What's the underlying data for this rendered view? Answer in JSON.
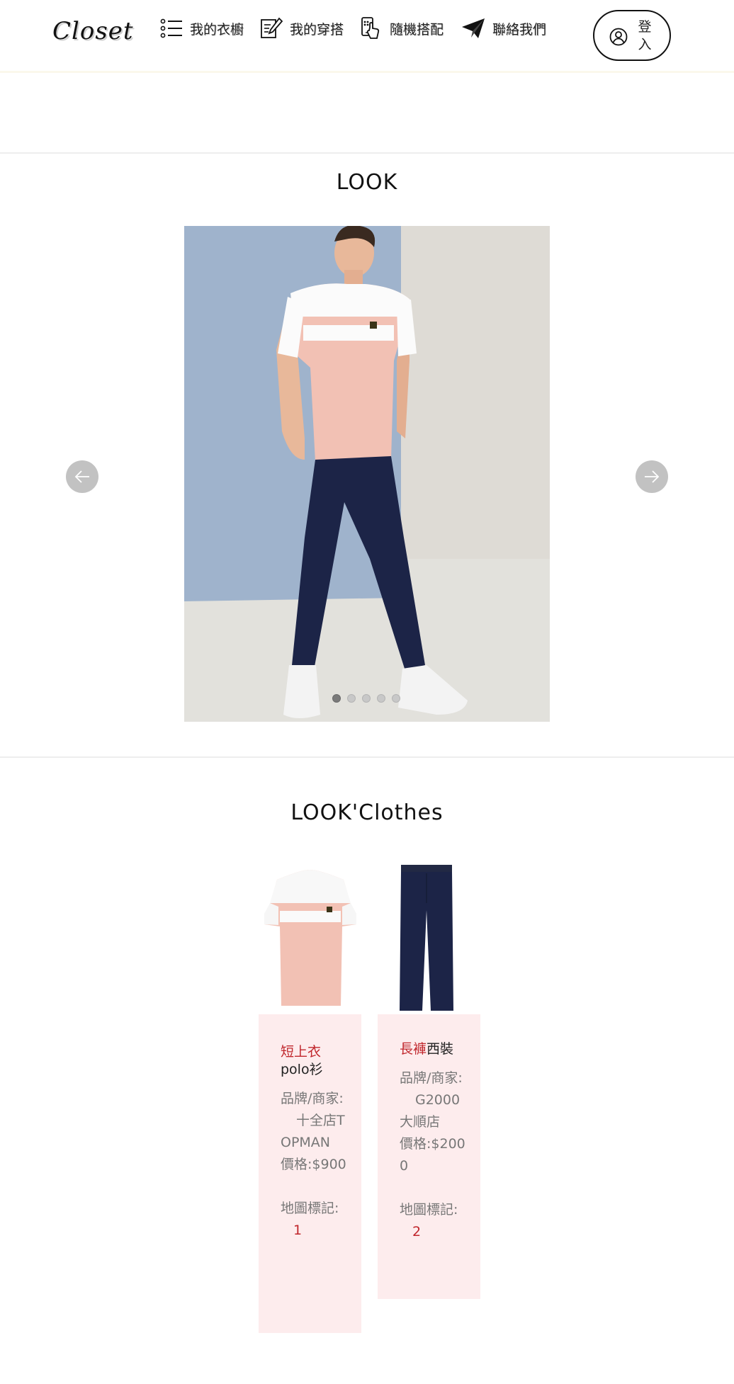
{
  "header": {
    "logo": "Closet",
    "nav": [
      {
        "label": "我的衣櫥",
        "icon": "list-icon"
      },
      {
        "label": "我的穿搭",
        "icon": "edit-note-icon"
      },
      {
        "label": "隨機搭配",
        "icon": "phone-tap-icon"
      },
      {
        "label": "聯絡我們",
        "icon": "paper-plane-icon"
      }
    ],
    "login": {
      "label": "登入",
      "icon": "user-circle-icon"
    }
  },
  "look": {
    "title": "LOOK",
    "prev_icon": "arrow-left-icon",
    "next_icon": "arrow-right-icon",
    "slide_count": 5,
    "active_slide": 1
  },
  "look_clothes": {
    "title": "LOOK'Clothes",
    "items": [
      {
        "category": "短上衣",
        "name": "polo衫",
        "brand_label": "品牌/商家:",
        "brand_value": "十全店TOPMAN",
        "price_label": "價格:",
        "price_value": "$900",
        "map_label": "地圖標記:",
        "map_value": "1"
      },
      {
        "category": "長褲",
        "name": "西裝",
        "brand_label": "品牌/商家:",
        "brand_value": "G2000大順店",
        "price_label": "價格:",
        "price_value": "$2000",
        "map_label": "地圖標記:",
        "map_value": "2"
      }
    ]
  },
  "colors": {
    "accent_red": "#c0262c",
    "card_background": "#fdeced",
    "polo_pink": "#f2c1b4",
    "pants_navy": "#1c2447"
  }
}
